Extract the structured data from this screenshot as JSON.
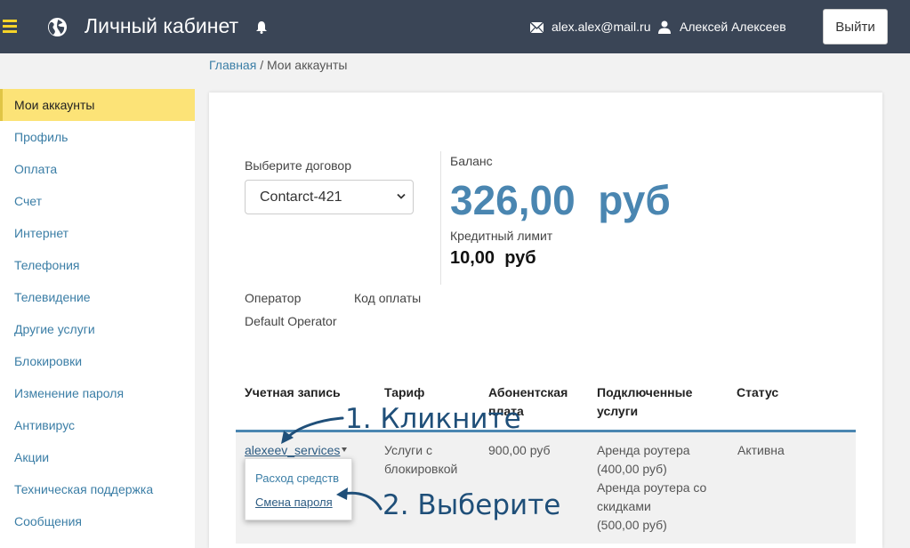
{
  "header": {
    "title": "Личный кабинет",
    "email": "alex.alex@mail.ru",
    "username": "Алексей Алексеев",
    "logout_label": "Выйти",
    "icons": [
      "menu-icon",
      "globe-icon",
      "bell-icon",
      "mail-icon",
      "user-icon"
    ],
    "accent_color": "#f5d328",
    "bg_color": "#3a4556"
  },
  "breadcrumb": {
    "home": "Главная",
    "separator": "/",
    "current": "Мои аккаунты"
  },
  "sidebar": {
    "items": [
      {
        "label": "Мои аккаунты",
        "active": true
      },
      {
        "label": "Профиль"
      },
      {
        "label": "Оплата"
      },
      {
        "label": "Счет"
      },
      {
        "label": "Интернет"
      },
      {
        "label": "Телефония"
      },
      {
        "label": "Телевидение"
      },
      {
        "label": "Другие услуги"
      },
      {
        "label": "Блокировки"
      },
      {
        "label": "Изменение пароля"
      },
      {
        "label": "Антивирус"
      },
      {
        "label": "Акции"
      },
      {
        "label": "Техническая поддержка"
      },
      {
        "label": "Сообщения"
      }
    ],
    "active_color": "#fce377"
  },
  "contract": {
    "label": "Выберите договор",
    "selected": "Contarct-421"
  },
  "balance": {
    "label": "Баланс",
    "value": "326,00",
    "currency": "руб",
    "credit_label": "Кредитный лимит",
    "credit_value": "10,00",
    "credit_currency": "руб",
    "color": "#4a86b1"
  },
  "operator": {
    "label": "Оператор",
    "value": "Default Operator",
    "payment_code_label": "Код оплаты"
  },
  "table": {
    "headers": {
      "account": "Учетная запись",
      "tariff": "Тариф",
      "fee_line1": "Абонентская",
      "fee_line2": "плата",
      "services_line1": "Подключенные",
      "services_line2": "услуги",
      "status": "Статус"
    },
    "row": {
      "account": "alexeev_services",
      "tariff_line1": "Услуги с",
      "tariff_line2": "блокировкой",
      "fee": "900,00 руб",
      "services": [
        "Аренда роутера",
        "(400,00 руб)",
        "Аренда роутера со",
        "скидками",
        "(500,00 руб)"
      ],
      "status": "Активна"
    },
    "dropdown": {
      "items": [
        "Расход средств",
        "Смена пароля"
      ]
    }
  },
  "annotations": {
    "step1": "1. Кликните",
    "step2": "2. Выберите"
  }
}
